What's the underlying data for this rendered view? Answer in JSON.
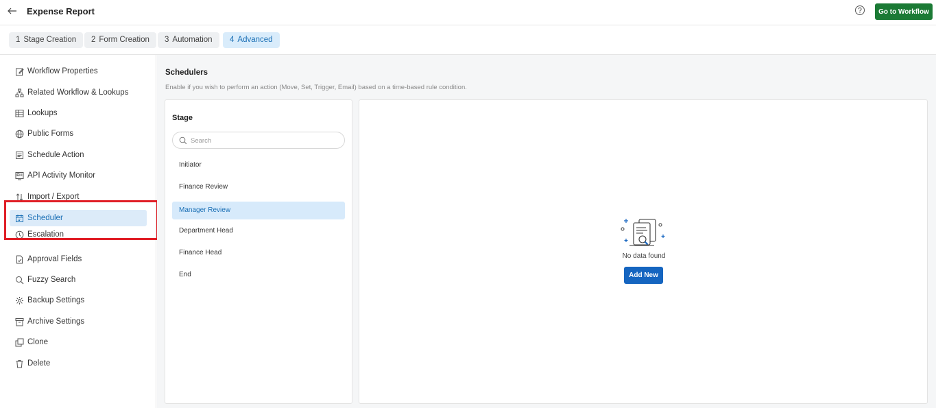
{
  "header": {
    "title": "Expense Report",
    "go_to_workflow_label": "Go to Workflow"
  },
  "tabs": [
    {
      "num": "1",
      "label": "Stage Creation"
    },
    {
      "num": "2",
      "label": "Form Creation"
    },
    {
      "num": "3",
      "label": "Automation"
    },
    {
      "num": "4",
      "label": "Advanced"
    }
  ],
  "sidebar": {
    "items": [
      {
        "label": "Workflow Properties",
        "icon": "edit-icon"
      },
      {
        "label": "Related Workflow & Lookups",
        "icon": "hierarchy-icon"
      },
      {
        "label": "Lookups",
        "icon": "table-icon"
      },
      {
        "label": "Public Forms",
        "icon": "globe-icon"
      },
      {
        "label": "Schedule Action",
        "icon": "list-icon"
      },
      {
        "label": "API Activity Monitor",
        "icon": "monitor-icon"
      },
      {
        "label": "Import / Export",
        "icon": "import-export-icon"
      },
      {
        "label": "Scheduler",
        "icon": "calendar-icon"
      },
      {
        "label": "Escalation",
        "icon": "escalation-icon"
      },
      {
        "label": "Approval Fields",
        "icon": "document-icon"
      },
      {
        "label": "Fuzzy Search",
        "icon": "search-icon"
      },
      {
        "label": "Backup Settings",
        "icon": "gear-icon"
      },
      {
        "label": "Archive Settings",
        "icon": "archive-icon"
      },
      {
        "label": "Clone",
        "icon": "clone-icon"
      },
      {
        "label": "Delete",
        "icon": "trash-icon"
      }
    ]
  },
  "main": {
    "title": "Schedulers",
    "description": "Enable if you wish to perform an action (Move, Set, Trigger, Email) based on a time-based rule condition.",
    "stage_panel": {
      "title": "Stage",
      "search_placeholder": "Search",
      "stages": [
        "Initiator",
        "Finance Review",
        "Manager Review",
        "Department Head",
        "Finance Head",
        "End"
      ]
    },
    "empty_state": {
      "text": "No data found",
      "add_new_label": "Add New"
    }
  },
  "colors": {
    "primary": "#1565c0",
    "success": "#1b7a35",
    "active_bg": "#dcebf9",
    "highlight": "#e01e26"
  }
}
